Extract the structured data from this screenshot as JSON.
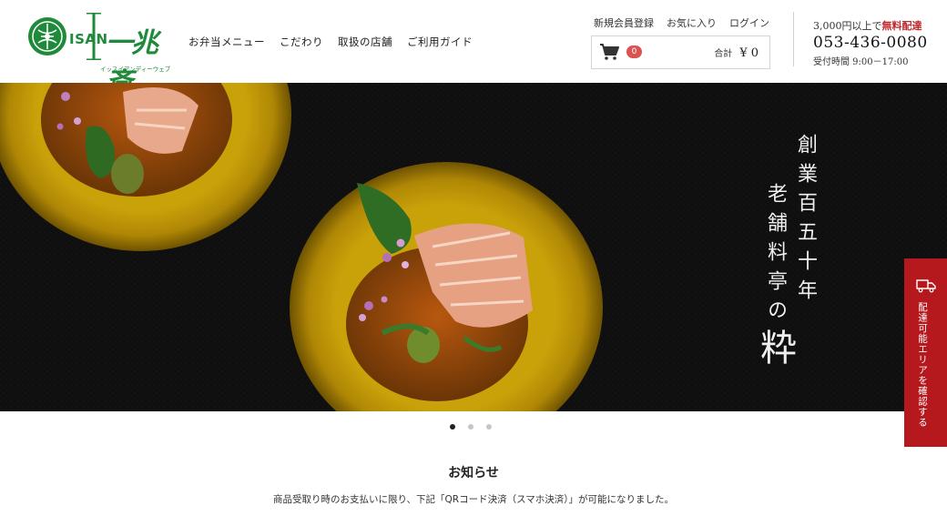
{
  "brand": {
    "prefix": "ISAN",
    "name": "一兆斎",
    "kana": "イッスイアンディーウェブ"
  },
  "nav": [
    {
      "label": "お弁当メニュー"
    },
    {
      "label": "こだわり"
    },
    {
      "label": "取扱の店舗"
    },
    {
      "label": "ご利用ガイド"
    }
  ],
  "member_links": [
    {
      "label": "新規会員登録"
    },
    {
      "label": "お気に入り"
    },
    {
      "label": "ログイン"
    }
  ],
  "cart": {
    "icon": "cart-icon",
    "count": "0",
    "total_label": "合計",
    "total_value": "¥ 0"
  },
  "contact": {
    "free_prefix": "3,000円以上で",
    "free_highlight": "無料配達",
    "phone": "053-436-0080",
    "hours": "受付時間 9:00－17:00"
  },
  "hero": {
    "copy_line1": "創業百五十年",
    "copy_line2_main": "老舗料亭の",
    "copy_line2_big": "粋"
  },
  "side_tab": {
    "label": "配達可能エリアを確認する",
    "icon": "truck-icon"
  },
  "slider": {
    "count": 3,
    "active": 1
  },
  "news": {
    "title": "お知らせ",
    "items": [
      "商品受取り時のお支払いに限り、下記「QRコード決済（スマホ決済）」が可能になりました。"
    ]
  },
  "colors": {
    "brand_green": "#1e8a3a",
    "accent_red": "#b5191e",
    "badge_red": "#d9534f",
    "plate_yellow": "#c9a20a",
    "hero_bg": "#101010"
  }
}
